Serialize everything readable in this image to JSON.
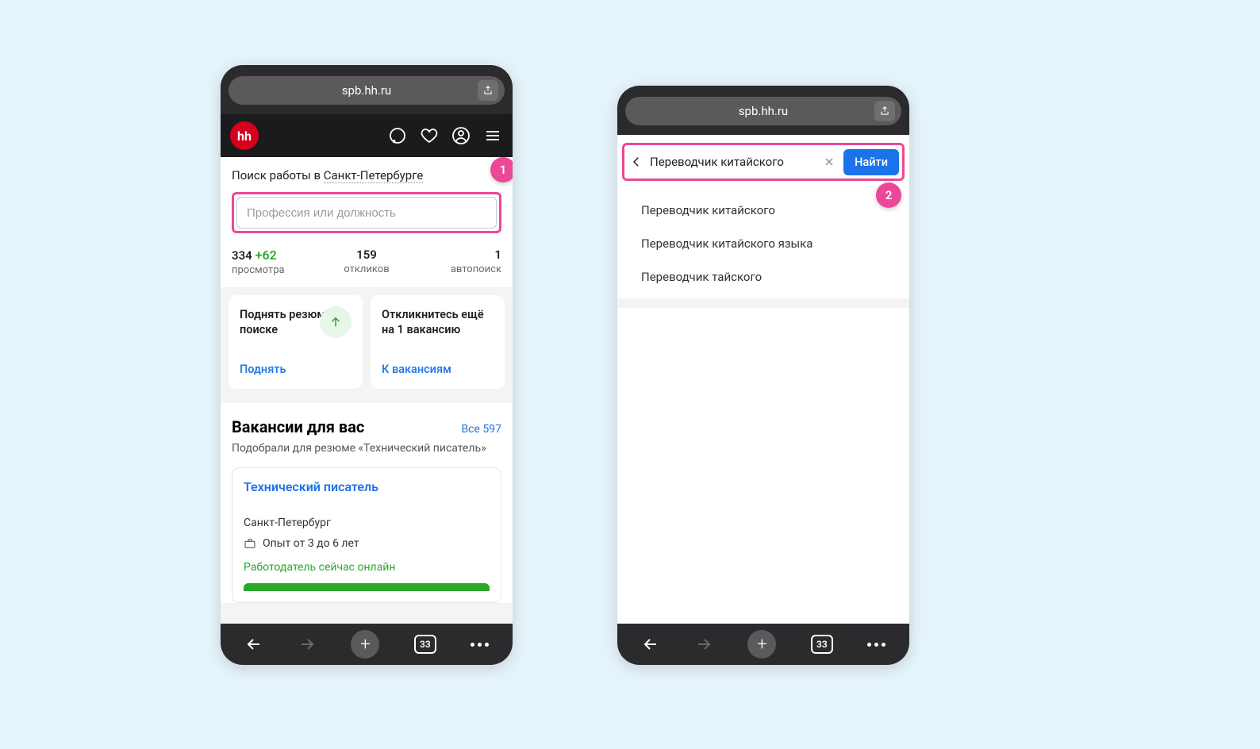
{
  "left": {
    "url": "spb.hh.ru",
    "logo_text": "hh",
    "search_title_prefix": "Поиск работы в ",
    "search_title_city": "Санкт-Петербурге",
    "search_placeholder": "Профессия или должность",
    "stats": {
      "views_num": "334",
      "views_delta": "+62",
      "views_label": "просмотра",
      "responses_num": "159",
      "responses_label": "откликов",
      "autosearch_num": "1",
      "autosearch_label": "автопоиск"
    },
    "card_raise": {
      "title": "Поднять резюме в поиске",
      "action": "Поднять"
    },
    "card_apply": {
      "title": "Откликнитесь ещё на 1 вакансию",
      "action": "К вакансиям"
    },
    "vacancies": {
      "heading": "Вакансии для вас",
      "all_link": "Все 597",
      "subtitle": "Подобрали для резюме «Технический писатель»",
      "item": {
        "title": "Технический писатель",
        "city": "Санкт-Петербург",
        "experience": "Опыт от 3 до 6 лет",
        "online": "Работодатель сейчас онлайн"
      }
    },
    "tabs_count": "33",
    "callout": "1"
  },
  "right": {
    "url": "spb.hh.ru",
    "search_value": "Переводчик китайского",
    "find_button": "Найти",
    "suggestions": [
      "Переводчик китайского",
      "Переводчик китайского языка",
      "Переводчик тайского"
    ],
    "tabs_count": "33",
    "callout": "2"
  }
}
